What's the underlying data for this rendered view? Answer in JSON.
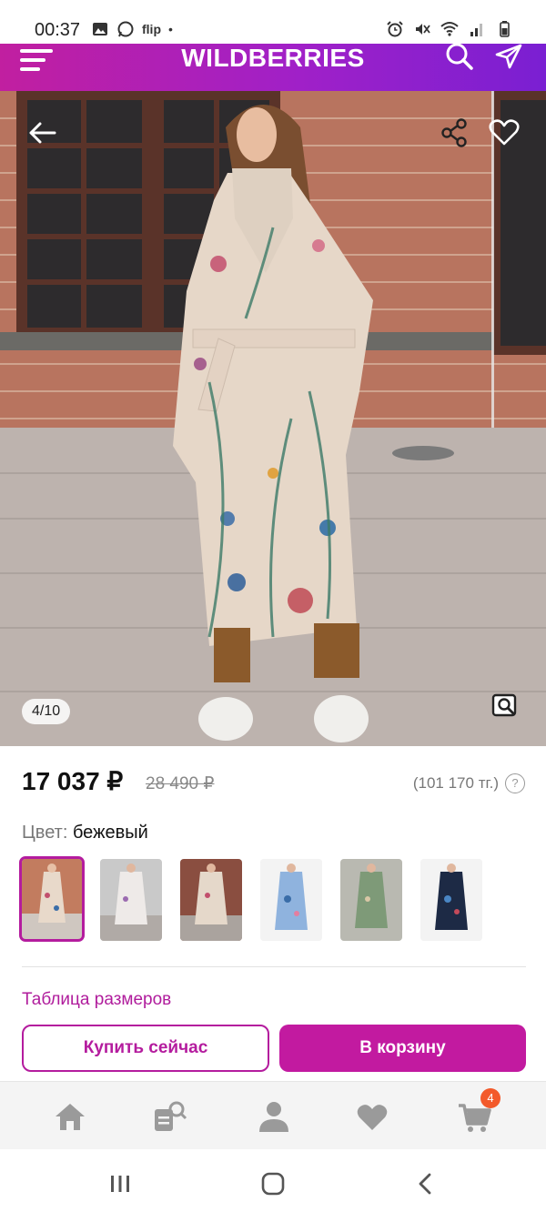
{
  "status_bar": {
    "time": "00:37",
    "left_icons": [
      "image-icon",
      "whatsapp-icon"
    ],
    "flip_label": "flip",
    "right_icons": [
      "alarm-icon",
      "mute-icon",
      "wifi-icon",
      "signal-icon",
      "battery-icon"
    ]
  },
  "header": {
    "logo": "WILDBERRIES",
    "icons": [
      "menu-icon",
      "search-icon",
      "send-icon"
    ]
  },
  "gallery": {
    "counter": "4/10",
    "current": 4,
    "total": 10,
    "icons": [
      "back-arrow-icon",
      "share-icon",
      "favorite-heart-icon",
      "image-search-icon"
    ]
  },
  "product": {
    "price": "17 037 ₽",
    "old_price": "28 490 ₽",
    "alt_price": "(101 170 тг.)",
    "help_symbol": "?",
    "color_label": "Цвет:",
    "color_value": "бежевый",
    "swatches_count": 6,
    "selected_swatch_index": 0,
    "size_table_link": "Таблица размеров"
  },
  "actions": {
    "buy_now": "Купить сейчас",
    "add_to_cart": "В корзину"
  },
  "bottom_nav": {
    "items": [
      "home-icon",
      "catalog-search-icon",
      "profile-icon",
      "favorites-icon",
      "cart-icon"
    ],
    "cart_badge": "4"
  },
  "colors": {
    "brand_primary": "#c21aa0",
    "brand_gradient_end": "#7a1fd2",
    "badge": "#f35a2b"
  }
}
